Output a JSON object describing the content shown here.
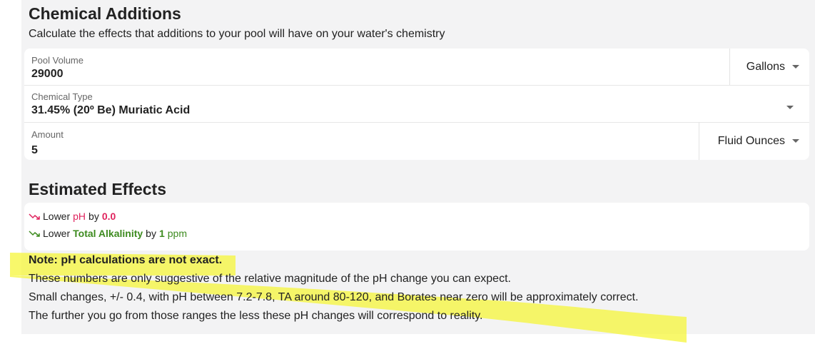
{
  "header": {
    "title": "Chemical Additions",
    "subtitle": "Calculate the effects that additions to your pool will have on your water's chemistry"
  },
  "form": {
    "pool_volume": {
      "label": "Pool Volume",
      "value": "29000",
      "unit": "Gallons"
    },
    "chemical_type": {
      "label": "Chemical Type",
      "value": "31.45% (20º Be) Muriatic Acid"
    },
    "amount": {
      "label": "Amount",
      "value": "5",
      "unit": "Fluid Ounces"
    }
  },
  "effects": {
    "title": "Estimated Effects",
    "items": [
      {
        "prefix": "Lower",
        "metric": "pH",
        "by": "by",
        "value": "0.0",
        "unit": "",
        "icon": "trending-down-icon"
      },
      {
        "prefix": "Lower",
        "metric": "Total Alkalinity",
        "by": "by",
        "value": "1",
        "unit": "ppm",
        "icon": "trending-down-icon"
      }
    ]
  },
  "note": {
    "heading": "Note: pH calculations are not exact.",
    "lines": [
      "These numbers are only suggestive of the relative magnitude of the pH change you can expect.",
      "Small changes, +/- 0.4, with pH between 7.2-7.8, TA around 80-120, and Borates near zero will be approximately correct.",
      "The further you go from those ranges the less these pH changes will correspond to reality."
    ]
  },
  "colors": {
    "ph": "#e0245e",
    "alkalinity": "#3d8b1f",
    "highlighter": "#f5f53a",
    "panel_bg": "#f3f3f4"
  }
}
